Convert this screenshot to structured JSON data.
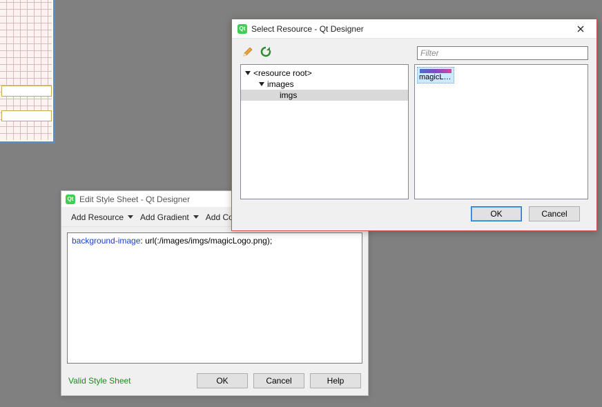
{
  "styleSheetDialog": {
    "title": "Edit Style Sheet - Qt Designer",
    "menu": {
      "addResource": "Add Resource",
      "addGradient": "Add Gradient",
      "addColor": "Add Colo"
    },
    "editor": {
      "property": "background-image",
      "value": ": url(:/images/imgs/magicLogo.png);"
    },
    "status": "Valid Style Sheet",
    "buttons": {
      "ok": "OK",
      "cancel": "Cancel",
      "help": "Help"
    }
  },
  "resourceDialog": {
    "title": "Select Resource - Qt Designer",
    "filterPlaceholder": "Filter",
    "tree": {
      "root": "<resource root>",
      "level1": "images",
      "level2": "imgs"
    },
    "selectedThumb": "magicLo...",
    "buttons": {
      "ok": "OK",
      "cancel": "Cancel"
    }
  }
}
